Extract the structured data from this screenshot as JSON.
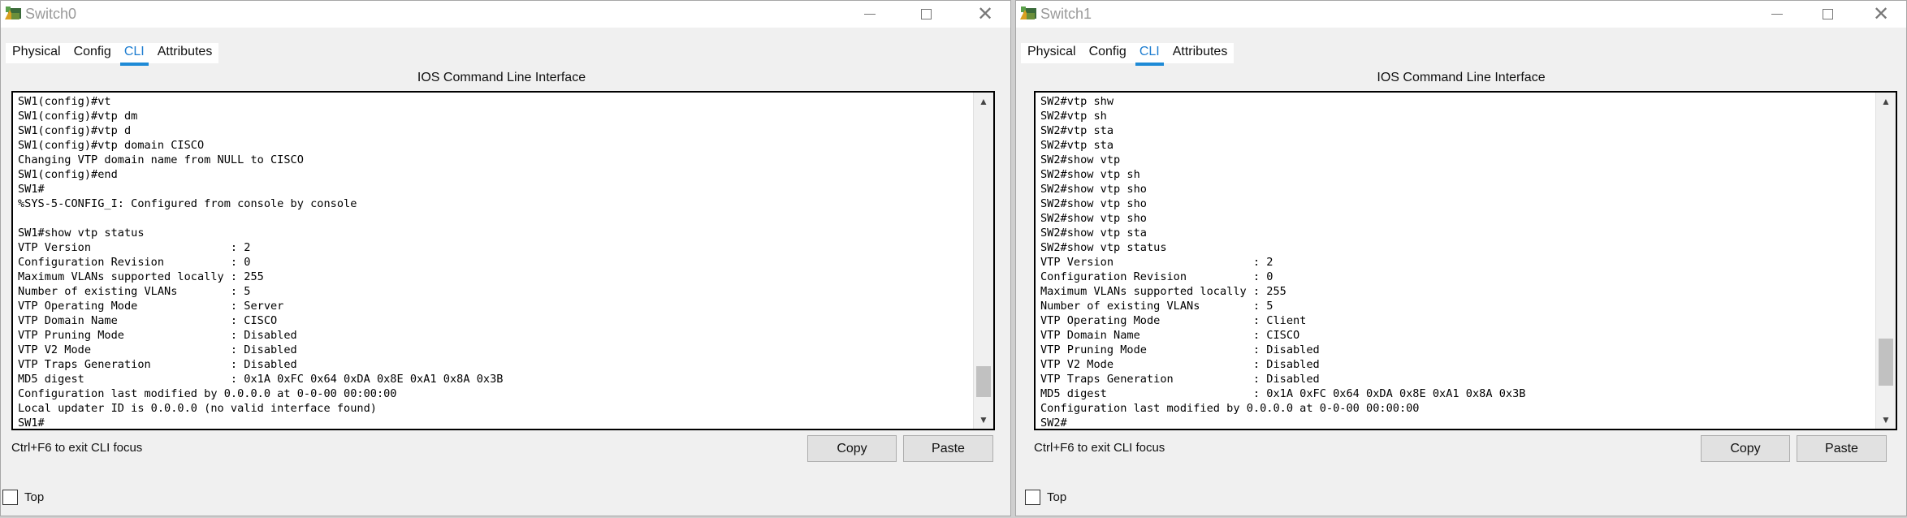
{
  "windows": [
    {
      "title": "Switch0",
      "tabs": [
        "Physical",
        "Config",
        "CLI",
        "Attributes"
      ],
      "active_tab": "CLI",
      "cli_heading": "IOS Command Line Interface",
      "cli_lines": [
        "SW1(config)#vt",
        "SW1(config)#vtp dm",
        "SW1(config)#vtp d",
        "SW1(config)#vtp domain CISCO",
        "Changing VTP domain name from NULL to CISCO",
        "SW1(config)#end",
        "SW1#",
        "%SYS-5-CONFIG_I: Configured from console by console",
        "",
        "SW1#show vtp status",
        "VTP Version                     : 2",
        "Configuration Revision          : 0",
        "Maximum VLANs supported locally : 255",
        "Number of existing VLANs        : 5",
        "VTP Operating Mode              : Server",
        "VTP Domain Name                 : CISCO",
        "VTP Pruning Mode                : Disabled",
        "VTP V2 Mode                     : Disabled",
        "VTP Traps Generation            : Disabled",
        "MD5 digest                      : 0x1A 0xFC 0x64 0xDA 0x8E 0xA1 0x8A 0x3B",
        "Configuration last modified by 0.0.0.0 at 0-0-00 00:00:00",
        "Local updater ID is 0.0.0.0 (no valid interface found)",
        "SW1#"
      ],
      "scroll_position": 0.95,
      "hint": "Ctrl+F6 to exit CLI focus",
      "copy_label": "Copy",
      "paste_label": "Paste",
      "top_label": "Top",
      "top_checked": false
    },
    {
      "title": "Switch1",
      "tabs": [
        "Physical",
        "Config",
        "CLI",
        "Attributes"
      ],
      "active_tab": "CLI",
      "cli_heading": "IOS Command Line Interface",
      "cli_lines": [
        "SW2#vtp shw",
        "SW2#vtp sh",
        "SW2#vtp sta",
        "SW2#vtp sta",
        "SW2#show vtp",
        "SW2#show vtp sh",
        "SW2#show vtp sho",
        "SW2#show vtp sho",
        "SW2#show vtp sho",
        "SW2#show vtp sta",
        "SW2#show vtp status",
        "VTP Version                     : 2",
        "Configuration Revision          : 0",
        "Maximum VLANs supported locally : 255",
        "Number of existing VLANs        : 5",
        "VTP Operating Mode              : Client",
        "VTP Domain Name                 : CISCO",
        "VTP Pruning Mode                : Disabled",
        "VTP V2 Mode                     : Disabled",
        "VTP Traps Generation            : Disabled",
        "MD5 digest                      : 0x1A 0xFC 0x64 0xDA 0x8E 0xA1 0x8A 0x3B",
        "Configuration last modified by 0.0.0.0 at 0-0-00 00:00:00",
        "SW2#"
      ],
      "scroll_position": 0.9,
      "hint": "Ctrl+F6 to exit CLI focus",
      "copy_label": "Copy",
      "paste_label": "Paste",
      "top_label": "Top",
      "top_checked": false
    }
  ],
  "icons": {
    "app": "network-device-icon",
    "minimize": "minimize-icon",
    "maximize": "maximize-icon",
    "close": "close-icon",
    "scroll_up": "chevron-up-icon",
    "scroll_down": "chevron-down-icon"
  },
  "colors": {
    "active_tab": "#1e7dd0",
    "tab_underline": "#1e8ad6",
    "title_text": "#9a9a9a",
    "window_bg": "#f0f0f0"
  }
}
